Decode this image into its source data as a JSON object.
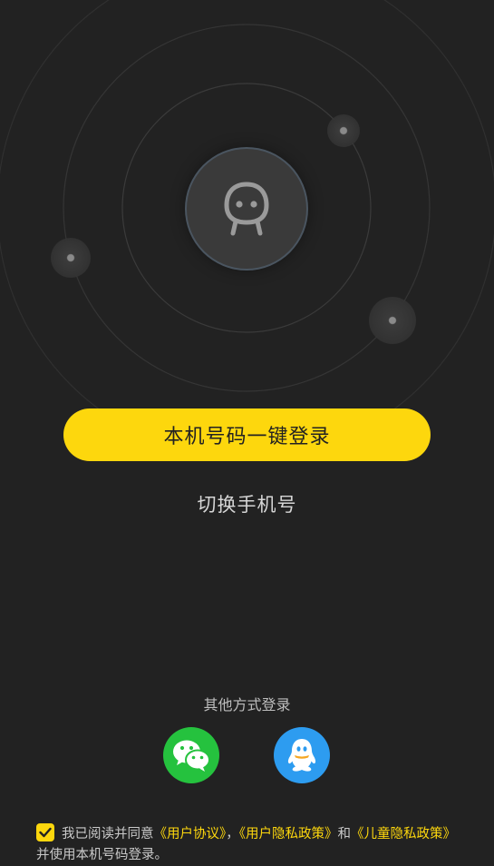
{
  "hero": {
    "avatar_icon": "robot-face-icon",
    "accent_color": "#fdd70d"
  },
  "login": {
    "one_click_label": "本机号码一键登录",
    "switch_phone_label": "切换手机号"
  },
  "other_login": {
    "title": "其他方式登录",
    "methods": [
      {
        "icon": "wechat-icon",
        "color": "#25c23e"
      },
      {
        "icon": "qq-icon",
        "color": "#2d9cf0"
      }
    ]
  },
  "agreement": {
    "checked": true,
    "prefix": "我已阅读并同意",
    "user_agreement": "《用户协议》",
    "comma": "，",
    "privacy_policy": "《用户隐私政策》",
    "and": "和",
    "child_privacy": "《儿童隐私政策》",
    "suffix": "并使用本机号码登录。"
  }
}
